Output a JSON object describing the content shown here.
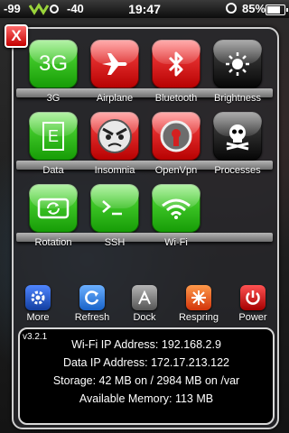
{
  "status_bar": {
    "signal_left": "-99",
    "signal_right": "-40",
    "time": "19:47",
    "battery": "85%"
  },
  "close_button": {
    "label": "X"
  },
  "toggles": [
    {
      "label": "3G",
      "color": "green",
      "icon": "3g-text-icon",
      "glyph": "3G"
    },
    {
      "label": "Airplane",
      "color": "red",
      "icon": "airplane-icon"
    },
    {
      "label": "Bluetooth",
      "color": "red",
      "icon": "bluetooth-icon"
    },
    {
      "label": "Brightness",
      "color": "black",
      "icon": "brightness-icon"
    },
    {
      "label": "Data",
      "color": "green",
      "icon": "data-e-icon",
      "glyph": "E"
    },
    {
      "label": "Insomnia",
      "color": "red",
      "icon": "angry-face-icon"
    },
    {
      "label": "OpenVpn",
      "color": "red",
      "icon": "vpn-keyhole-icon"
    },
    {
      "label": "Processes",
      "color": "black",
      "icon": "skull-crossbones-icon"
    },
    {
      "label": "Rotation",
      "color": "green",
      "icon": "rotation-icon"
    },
    {
      "label": "SSH",
      "color": "green",
      "icon": "terminal-icon"
    },
    {
      "label": "Wi-Fi",
      "color": "green",
      "icon": "wifi-icon"
    }
  ],
  "dock": [
    {
      "label": "More",
      "icon": "gear-icon",
      "color": "#1f5fd0"
    },
    {
      "label": "Refresh",
      "icon": "refresh-icon",
      "color": "#2a7fe0"
    },
    {
      "label": "Dock",
      "icon": "app-store-icon",
      "color": "#8a8a8a"
    },
    {
      "label": "Respring",
      "icon": "burst-icon",
      "color": "#e8531f"
    },
    {
      "label": "Power",
      "icon": "power-icon",
      "color": "#d01919"
    }
  ],
  "info": {
    "version": "v3.2.1",
    "wifi_ip": "Wi-Fi IP Address: 192.168.2.9",
    "data_ip": "Data IP Address: 172.17.213.122",
    "storage": "Storage: 42 MB on / 2984 MB on /var",
    "memory": "Available Memory: 113 MB"
  }
}
